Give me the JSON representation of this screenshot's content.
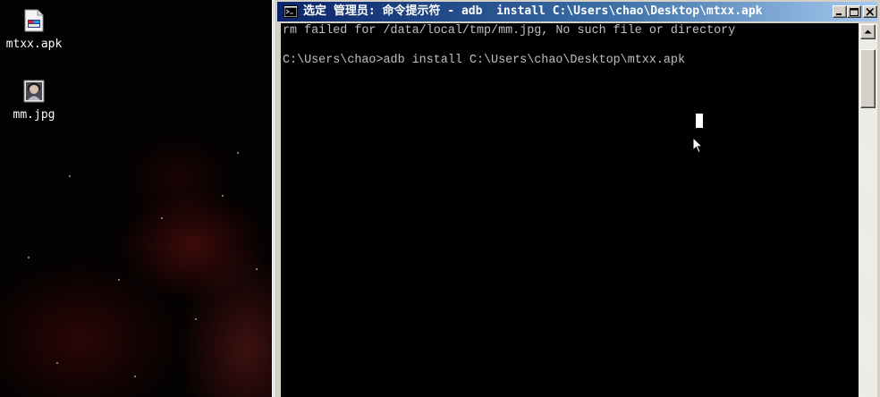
{
  "desktop": {
    "icons": [
      {
        "label": "mtxx.apk",
        "icon": "apk-file-icon"
      },
      {
        "label": "mm.jpg",
        "icon": "jpg-image-icon"
      }
    ]
  },
  "window": {
    "title": "选定 管理员: 命令提示符 - adb  install C:\\Users\\chao\\Desktop\\mtxx.apk",
    "icon": "cmd-console-icon",
    "buttons": {
      "minimize": "minimize-icon",
      "maximize": "maximize-icon",
      "close": "close-icon"
    },
    "titlebar_colors": [
      "#0a246a",
      "#3a6ea5",
      "#a6caf0"
    ]
  },
  "console": {
    "lines": [
      "rm failed for /data/local/tmp/mm.jpg, No such file or directory",
      "",
      "C:\\Users\\chao>adb install C:\\Users\\chao\\Desktop\\mtxx.apk"
    ],
    "background": "#000000",
    "text_color": "#c0c0c0"
  }
}
